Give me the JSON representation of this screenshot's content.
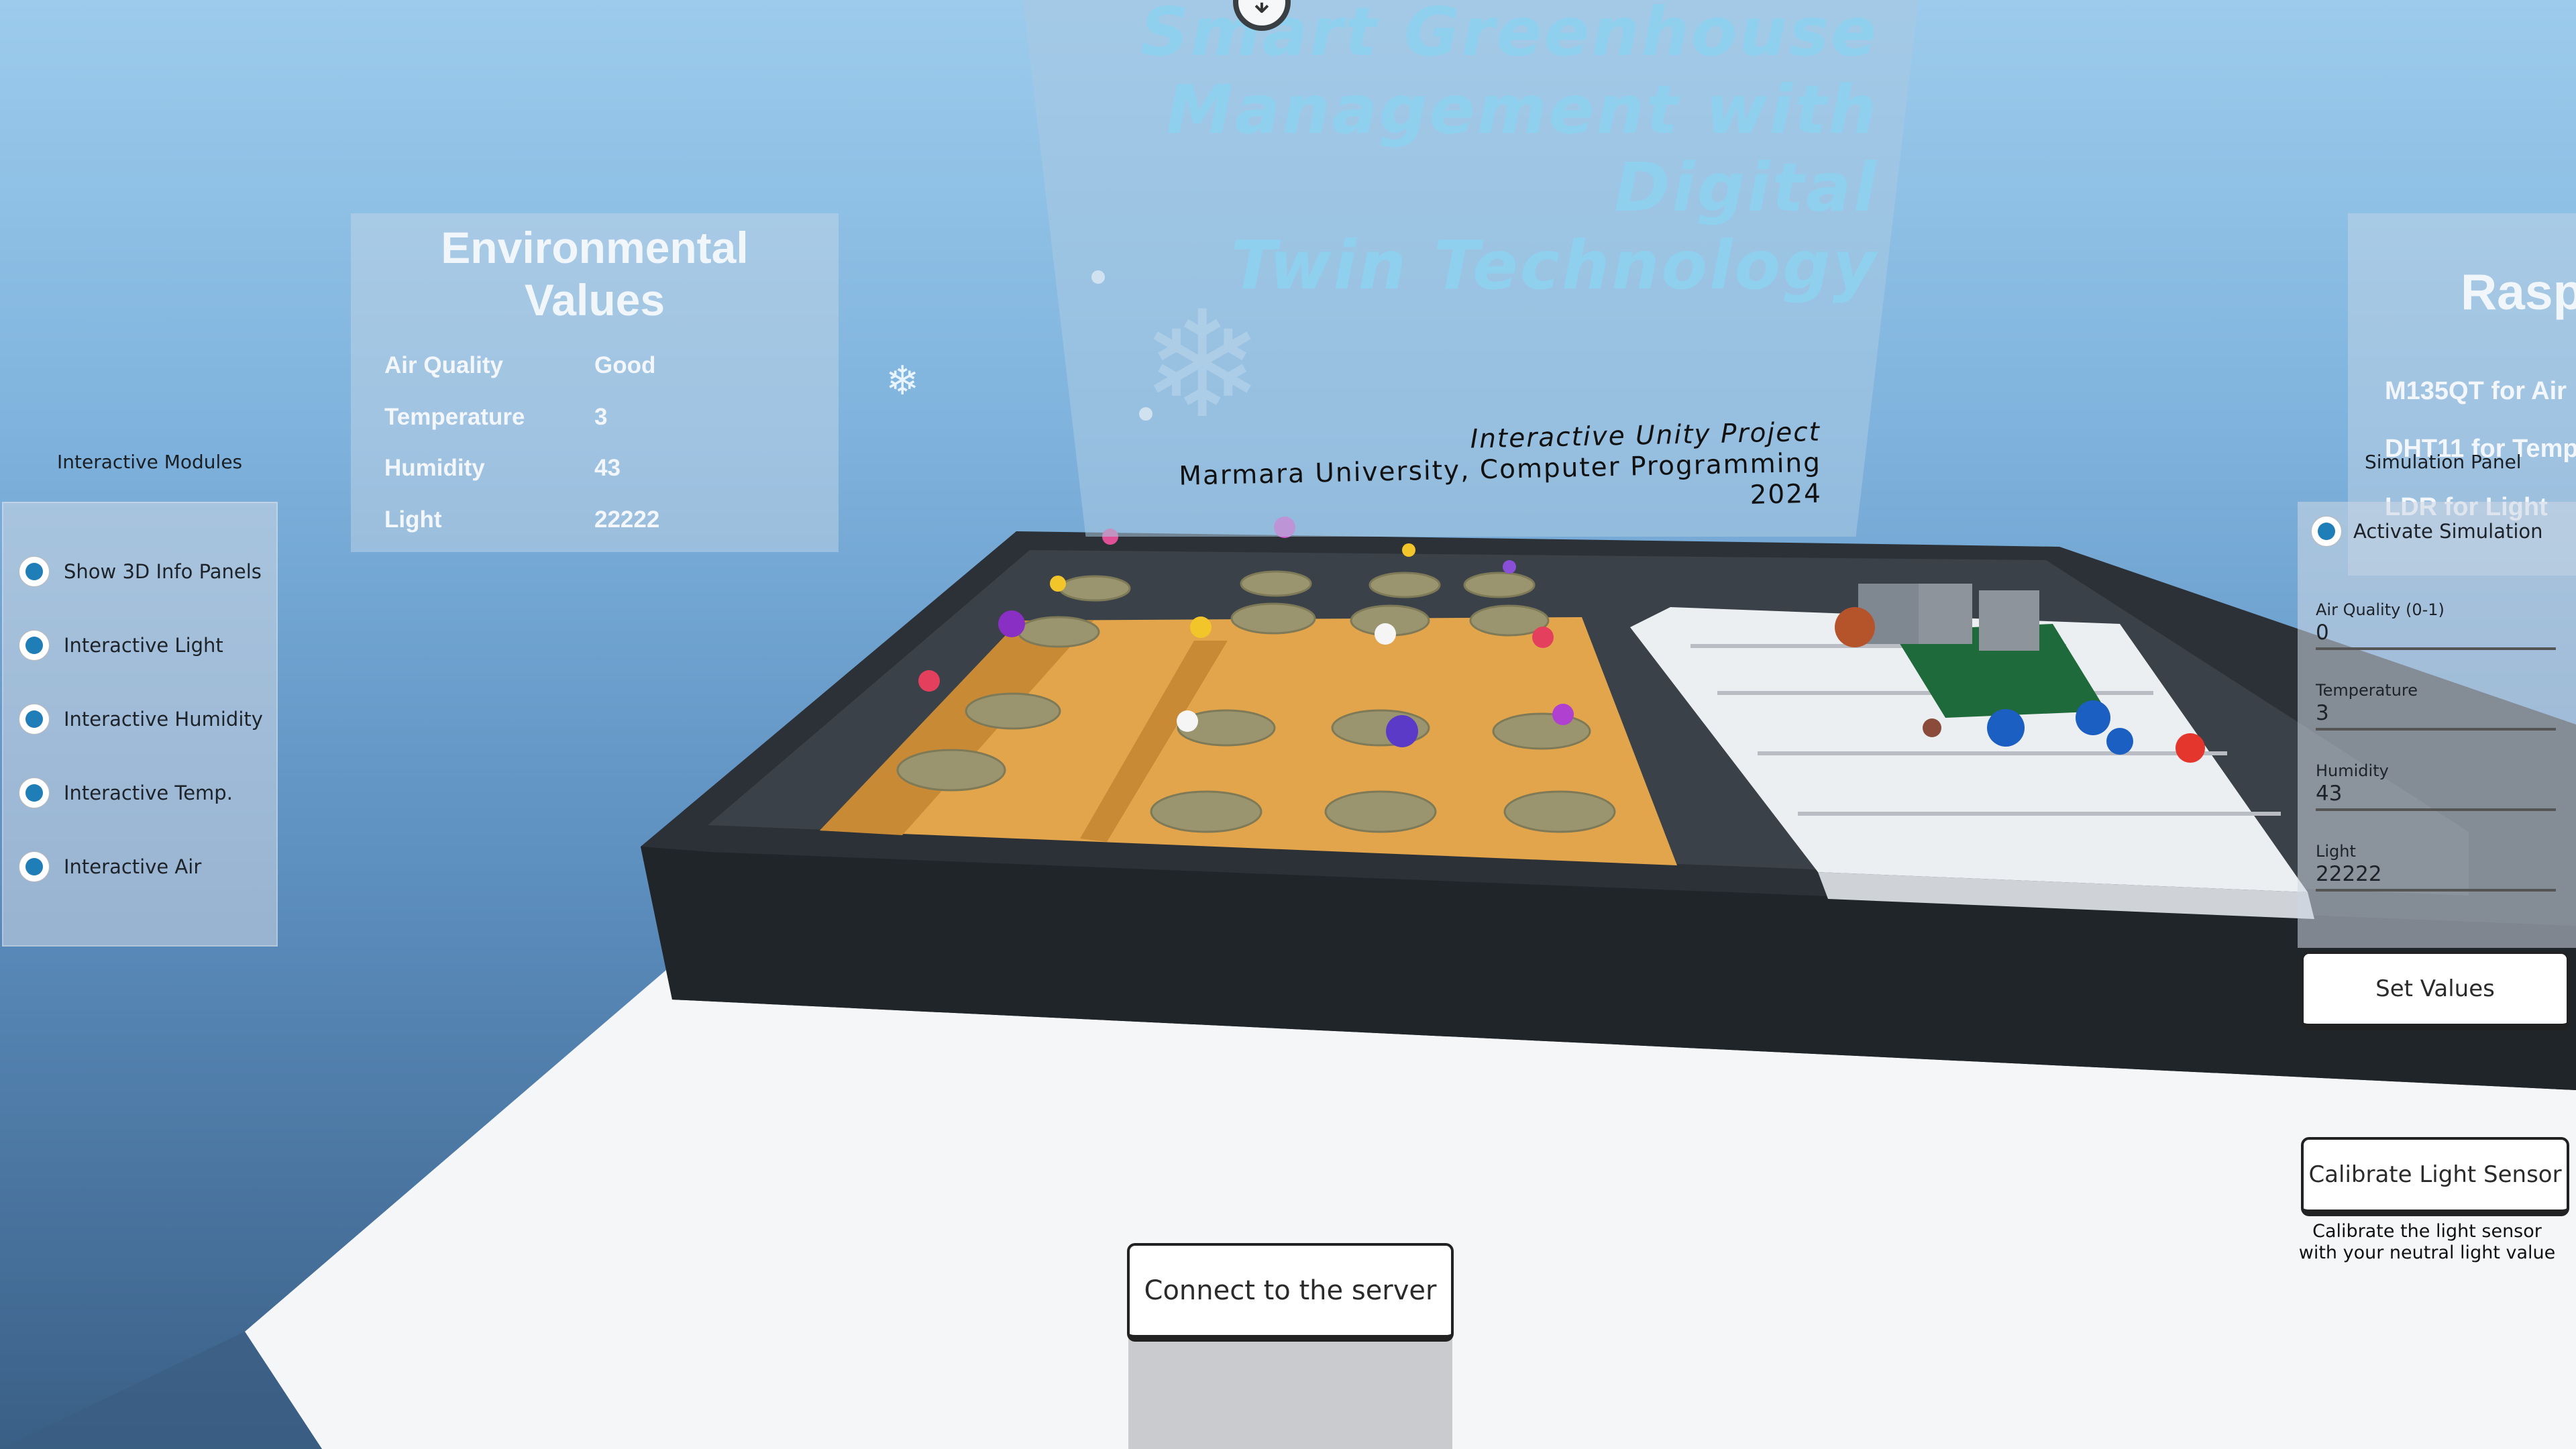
{
  "banner": {
    "title": "Smart Greenhouse\nManagement with Digital\nTwin Technology",
    "credit_line1": "Interactive Unity Project",
    "credit_line2": "Marmara University, Computer Programming 2024"
  },
  "environmental_panel": {
    "title": "Environmental\nValues",
    "rows": [
      {
        "label": "Air Quality",
        "value": "Good"
      },
      {
        "label": "Temperature",
        "value": "3"
      },
      {
        "label": "Humidity",
        "value": "43"
      },
      {
        "label": "Light",
        "value": "22222"
      }
    ]
  },
  "raspberry_panel": {
    "title": "Rasp",
    "lines": [
      "M135QT for Air",
      "DHT11 for Temp",
      "LDR for Light"
    ]
  },
  "modules": {
    "caption": "Interactive Modules",
    "items": [
      {
        "label": "Show 3D Info Panels",
        "checked": true
      },
      {
        "label": "Interactive Light",
        "checked": true
      },
      {
        "label": "Interactive Humidity",
        "checked": true
      },
      {
        "label": "Interactive Temp.",
        "checked": true
      },
      {
        "label": "Interactive Air",
        "checked": true
      }
    ]
  },
  "simulation": {
    "caption": "Simulation Panel",
    "activate_label": "Activate Simulation",
    "fields": [
      {
        "label": "Air Quality (0-1)",
        "value": "0"
      },
      {
        "label": "Temperature",
        "value": "3"
      },
      {
        "label": "Humidity",
        "value": "43"
      },
      {
        "label": "Light",
        "value": "22222"
      }
    ],
    "set_values_label": "Set Values",
    "calibrate_label": "Calibrate Light Sensor",
    "calibrate_note": "Calibrate the light sensor with your neutral light value"
  },
  "connect_label": "Connect to the server",
  "colors": {
    "accent": "#1f7db7",
    "banner_text": "#8fd0ef",
    "tray": "#2c3137"
  }
}
